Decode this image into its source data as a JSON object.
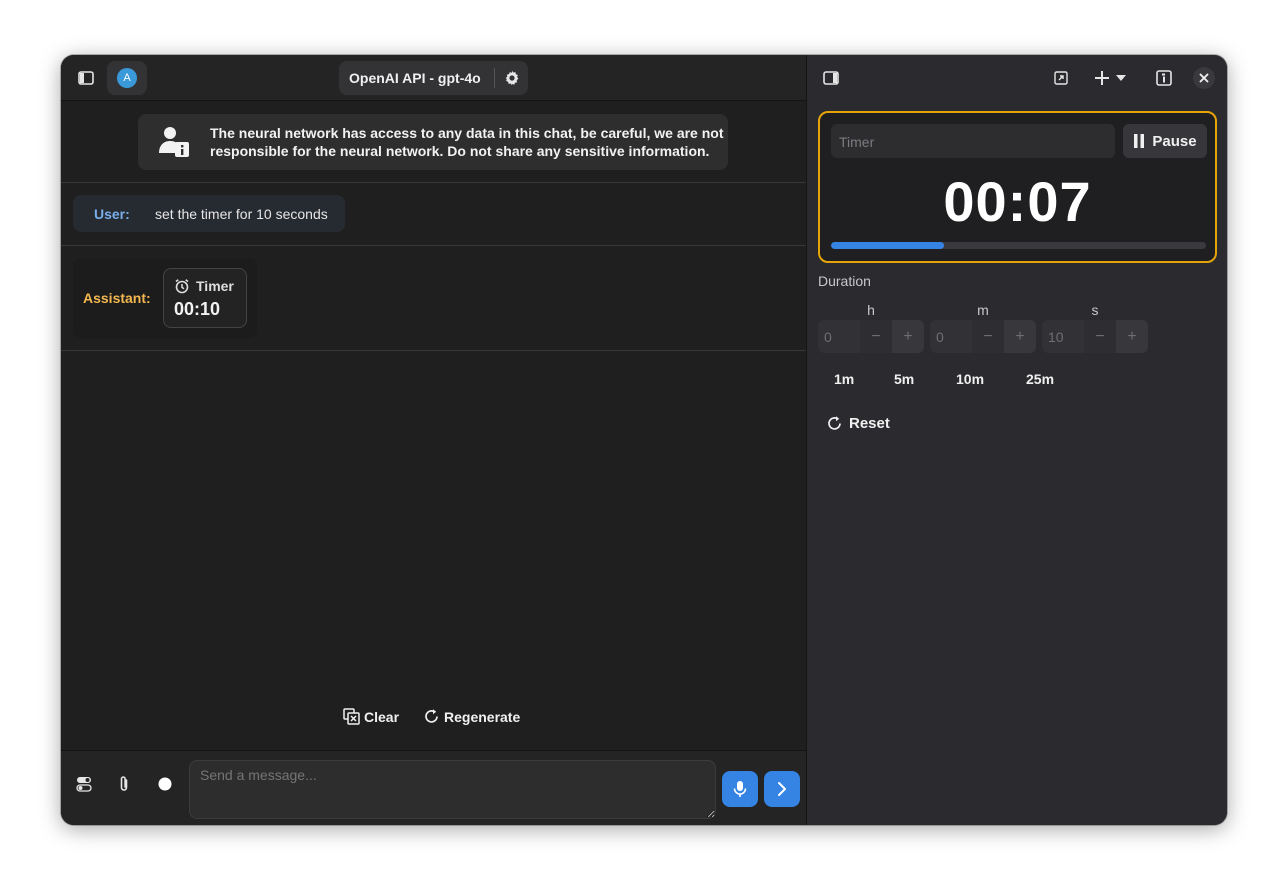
{
  "header": {
    "avatar_letter": "A",
    "model_label": "OpenAI API - gpt-4o"
  },
  "notice": {
    "line1": "The neural network has access to any data in this chat, be careful, we are not",
    "line2": "responsible for the neural network. Do not share any sensitive information."
  },
  "messages": {
    "user": {
      "role": "User:",
      "text": "set the timer for 10 seconds"
    },
    "assistant": {
      "role": "Assistant:",
      "timer_title": "Timer",
      "timer_value": "00:10"
    }
  },
  "actions": {
    "clear": "Clear",
    "regenerate": "Regenerate"
  },
  "composer": {
    "placeholder": "Send a message..."
  },
  "timer_panel": {
    "name_placeholder": "Timer",
    "pause_label": "Pause",
    "time": "00:07",
    "progress": 0.3,
    "duration_label": "Duration",
    "units": {
      "h": "h",
      "m": "m",
      "s": "s"
    },
    "values": {
      "h": "0",
      "m": "0",
      "s": "10"
    },
    "minus": "−",
    "plus": "+",
    "presets": [
      "1m",
      "5m",
      "10m",
      "25m"
    ],
    "reset_label": "Reset"
  },
  "colors": {
    "accent": "#3584e4",
    "warning": "#e5a50a",
    "assistant_role": "#f3b74f",
    "user_role": "#78aeea"
  }
}
